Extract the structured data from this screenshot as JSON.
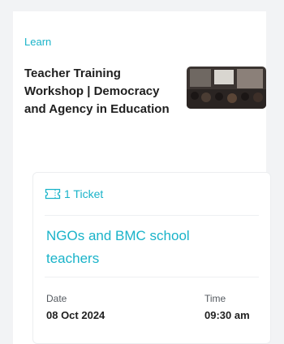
{
  "event": {
    "section_label": "Learn",
    "title": "Teacher Training Workshop | Democracy and Agency in Education",
    "thumbnail_icon": "event-photo"
  },
  "ticket": {
    "count_label": "1 Ticket",
    "icon": "ticket-icon",
    "name": "NGOs and BMC school teachers",
    "date_label": "Date",
    "date_value": "08 Oct 2024",
    "time_label": "Time",
    "time_value": "09:30 am"
  },
  "colors": {
    "accent": "#19b3c9",
    "text": "#1f1f1f",
    "muted": "#555a60",
    "background": "#f2f3f5"
  }
}
